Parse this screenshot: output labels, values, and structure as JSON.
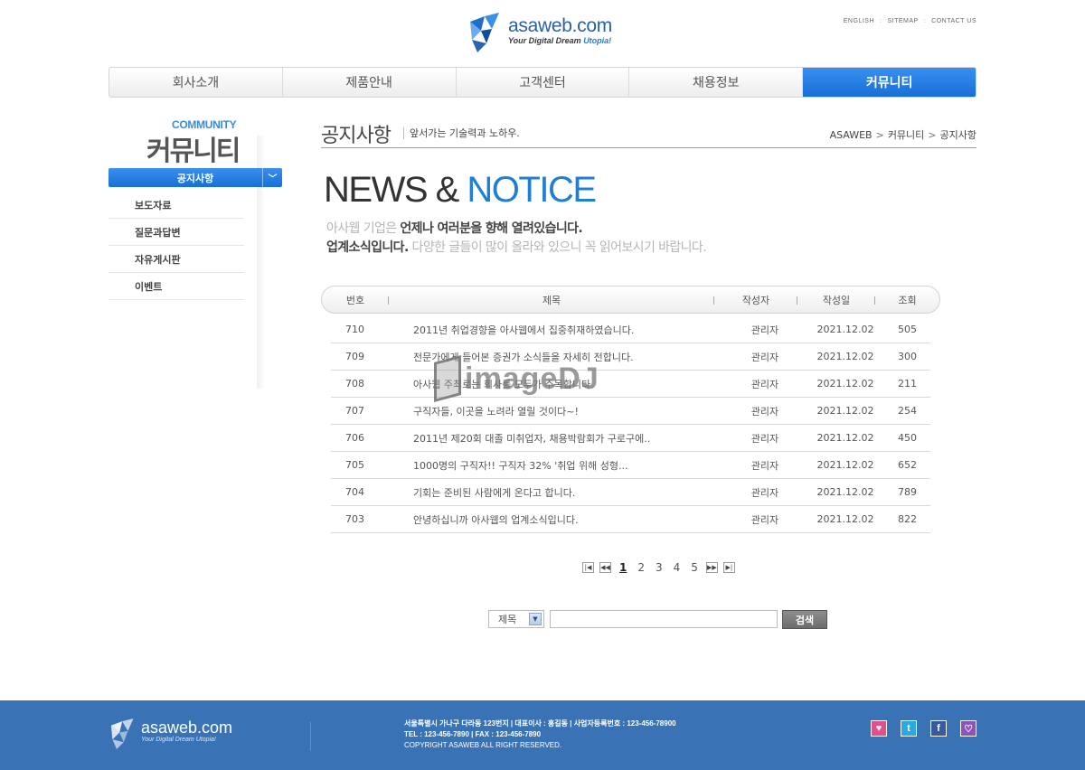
{
  "header": {
    "logo_name": "asaweb",
    "logo_tld": ".com",
    "logo_slogan_a": "Your Digital Dream ",
    "logo_slogan_b": "Utopia!",
    "top_links": [
      "ENGLISH",
      "SITEMAP",
      "CONTACT US"
    ]
  },
  "gnb": [
    "회사소개",
    "제품안내",
    "고객센터",
    "채용정보",
    "커뮤니티"
  ],
  "lnb": {
    "sub_title": "COMMUNITY",
    "title": "커뮤니티",
    "active": "공지사항",
    "items": [
      "보도자료",
      "질문과답변",
      "자유게시판",
      "이벤트"
    ]
  },
  "content": {
    "title": "공지사항",
    "desc": "앞서가는 기술력과 노하우.",
    "breadcrumb": [
      "ASAWEB",
      "커뮤니티",
      "공지사항"
    ],
    "hero_a": "NEWS & ",
    "hero_b": "NOTICE",
    "line1_a": "아사웹 기업은 ",
    "line1_b": "언제나 여러분을 향해 열려있습니다.",
    "line2_a": "업계소식입니다.",
    "line2_b": " 다양한 글들이 많이 올라와 있으니 꼭 읽어보시기 바랍니다."
  },
  "board": {
    "headers": [
      "번호",
      "제목",
      "작성자",
      "작성일",
      "조회"
    ],
    "rows": [
      {
        "num": "710",
        "title": "2011년 취업경향을 아사웹에서 집중취재하였습니다.",
        "writer": "관리자",
        "date": "2021.12.02",
        "views": "505"
      },
      {
        "num": "709",
        "title": "전문가에게 들어본 증권가 소식들을 자세히 전합니다.",
        "writer": "관리자",
        "date": "2021.12.02",
        "views": "300"
      },
      {
        "num": "708",
        "title": "아사웹 주최로는 회사를 모두가 주목합니다.",
        "writer": "관리자",
        "date": "2021.12.02",
        "views": "211"
      },
      {
        "num": "707",
        "title": "구직자들, 이곳을 노려라 열릴 것이다~!",
        "writer": "관리자",
        "date": "2021.12.02",
        "views": "254"
      },
      {
        "num": "706",
        "title": "2011년 제20회 대졸 미취업자, 채용박람회가 구로구에..",
        "writer": "관리자",
        "date": "2021.12.02",
        "views": "450"
      },
      {
        "num": "705",
        "title": "1000명의 구직자!! 구직자 32% '취업 위해 성형...",
        "writer": "관리자",
        "date": "2021.12.02",
        "views": "652"
      },
      {
        "num": "704",
        "title": "기회는 준비된 사람에게 온다고 합니다.",
        "writer": "관리자",
        "date": "2021.12.02",
        "views": "789"
      },
      {
        "num": "703",
        "title": "안녕하십니까 아사웹의 업계소식입니다.",
        "writer": "관리자",
        "date": "2021.12.02",
        "views": "822"
      }
    ]
  },
  "watermark": "imageDJ",
  "pager": {
    "pages": [
      "1",
      "2",
      "3",
      "4",
      "5"
    ],
    "current": "1",
    "first": "|◀",
    "prev": "◀◀",
    "next": "▶▶",
    "last": "▶|"
  },
  "search": {
    "select": "제목",
    "button": "검색"
  },
  "footer": {
    "logo_name": "asaweb.com",
    "logo_slogan": "Your Digital Dream Utopia!",
    "address": "서울특별시 가나구 다라동 123번지  |  대표이사 : 홍길동  |  사업자등록번호 : 123-456-78900",
    "tel": "TEL : 123-456-7890  |  FAX : 123-456-7890",
    "copyright": "COPYRIGHT ASAWEB ALL RIGHT RESERVED.",
    "sns": [
      "♥",
      "t",
      "f",
      "♡"
    ]
  }
}
